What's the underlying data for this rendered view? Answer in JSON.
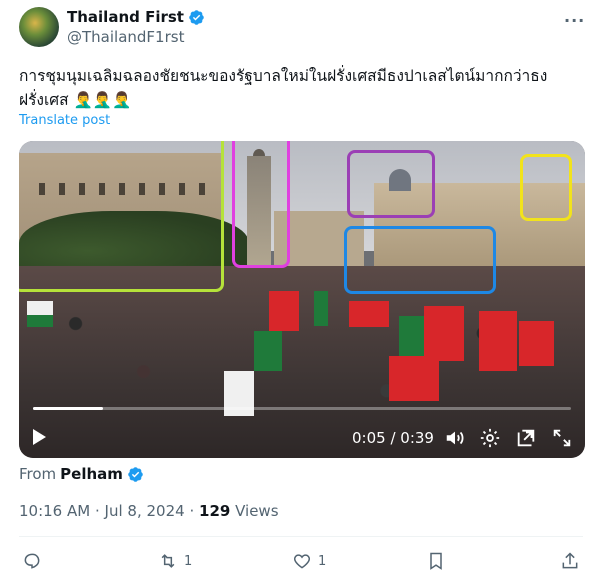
{
  "author": {
    "display_name": "Thailand First",
    "handle": "@ThailandF1rst"
  },
  "post": {
    "text": "การชุมนุมเฉลิมฉลองชัยชนะของรัฐบาลใหม่ในฝรั่งเศสมีธงปาเลสไตน์มากกว่าธงฝรั่งเศส 🤦‍♂️🤦‍♂️🤦‍♂️",
    "translate_label": "Translate post",
    "more_label": "···"
  },
  "video": {
    "current_time": "0:05",
    "separator": " / ",
    "duration": "0:39",
    "progress_fraction": 0.13,
    "annotation_colors": [
      "#b5e23a",
      "#e040e0",
      "#9b3fb5",
      "#1e88e5",
      "#f2e31b"
    ]
  },
  "source": {
    "prefix": "From",
    "name": "Pelham"
  },
  "meta": {
    "time": "10:16 AM",
    "dot": "·",
    "date": "Jul 8, 2024",
    "views_count": "129",
    "views_label": "Views"
  },
  "actions": {
    "reply_count": "",
    "repost_count": "1",
    "like_count": "1",
    "bookmark_count": ""
  },
  "icons": {
    "verified": "verified-badge-icon",
    "reply": "reply-icon",
    "repost": "repost-icon",
    "like": "heart-icon",
    "bookmark": "bookmark-icon",
    "share": "share-icon"
  },
  "colors": {
    "accent": "#1d9bf0",
    "muted": "#536471"
  }
}
